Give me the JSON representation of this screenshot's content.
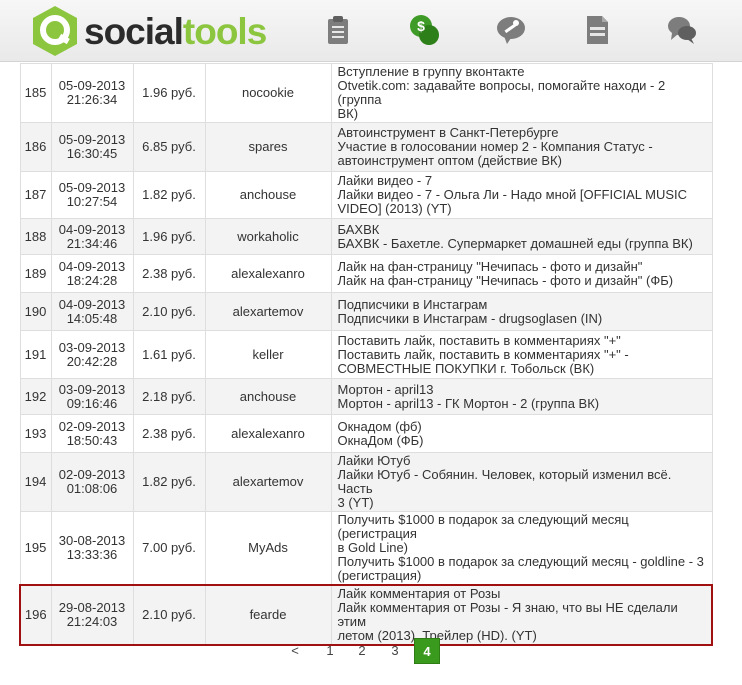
{
  "header": {
    "logo_part1": "social",
    "logo_part2": "tools",
    "nav": [
      {
        "icon": "clipboard-icon"
      },
      {
        "icon": "money-icon"
      },
      {
        "icon": "wrench-icon"
      },
      {
        "icon": "document-icon"
      },
      {
        "icon": "chat-icon"
      }
    ]
  },
  "table": {
    "rows": [
      {
        "id": "185",
        "date": "05-09-2013",
        "time": "21:26:34",
        "price": "1.96 руб.",
        "user": "nocookie",
        "lines": [
          "Вступление в группу вконтакте",
          "Otvetik.com: задавайте вопросы, помогайте находи - 2 (группа",
          "ВК)"
        ]
      },
      {
        "id": "186",
        "date": "05-09-2013",
        "time": "16:30:45",
        "price": "6.85 руб.",
        "user": "spares",
        "lines": [
          "Автоинструмент в Санкт-Петербурге",
          "Участие в голосовании номер 2 - Компания Статус -",
          "автоинструмент оптом (действие ВК)"
        ]
      },
      {
        "id": "187",
        "date": "05-09-2013",
        "time": "10:27:54",
        "price": "1.82 руб.",
        "user": "anchouse",
        "lines": [
          "Лайки видео - 7",
          "Лайки видео - 7 - Ольга Ли - Надо мной [OFFICIAL MUSIC",
          "VIDEO] (2013) (YT)"
        ]
      },
      {
        "id": "188",
        "date": "04-09-2013",
        "time": "21:34:46",
        "price": "1.96 руб.",
        "user": "workaholic",
        "lines": [
          "БАХВК",
          "БАХВК - Бахетле. Супермаркет домашней еды (группа ВК)"
        ]
      },
      {
        "id": "189",
        "date": "04-09-2013",
        "time": "18:24:28",
        "price": "2.38 руб.",
        "user": "alexalexanro",
        "lines": [
          "Лайк на фан-страницу \"Нечипась - фото и дизайн\"",
          "Лайк на фан-страницу \"Нечипась - фото и дизайн\" (ФБ)"
        ]
      },
      {
        "id": "190",
        "date": "04-09-2013",
        "time": "14:05:48",
        "price": "2.10 руб.",
        "user": "alexartemov",
        "lines": [
          "Подписчики в Инстаграм",
          "Подписчики в Инстаграм - drugsoglasen (IN)"
        ]
      },
      {
        "id": "191",
        "date": "03-09-2013",
        "time": "20:42:28",
        "price": "1.61 руб.",
        "user": "keller",
        "lines": [
          "Поставить лайк, поставить в комментариях \"+\"",
          "Поставить лайк, поставить в комментариях \"+\" -",
          "СОВМЕСТНЫЕ ПОКУПКИ г. Тобольск (ВК)"
        ]
      },
      {
        "id": "192",
        "date": "03-09-2013",
        "time": "09:16:46",
        "price": "2.18 руб.",
        "user": "anchouse",
        "lines": [
          "Мортон - april13",
          "Мортон - april13 - ГК Мортон - 2 (группа ВК)"
        ]
      },
      {
        "id": "193",
        "date": "02-09-2013",
        "time": "18:50:43",
        "price": "2.38 руб.",
        "user": "alexalexanro",
        "lines": [
          "Окнадом (фб)",
          "ОкнаДом (ФБ)"
        ]
      },
      {
        "id": "194",
        "date": "02-09-2013",
        "time": "01:08:06",
        "price": "1.82 руб.",
        "user": "alexartemov",
        "lines": [
          "Лайки Ютуб",
          "Лайки Ютуб - Собянин. Человек, который изменил всё. Часть",
          "3 (YT)"
        ]
      },
      {
        "id": "195",
        "date": "30-08-2013",
        "time": "13:33:36",
        "price": "7.00 руб.",
        "user": "MyAds",
        "lines": [
          "Получить $1000 в подарок за следующий месяц (регистрация",
          "в Gold Line)",
          "Получить $1000 в подарок за следующий месяц - goldline - 3",
          "(регистрация)"
        ]
      },
      {
        "id": "196",
        "date": "29-08-2013",
        "time": "21:24:03",
        "price": "2.10 руб.",
        "user": "fearde",
        "lines": [
          "Лайк комментария от Розы",
          "Лайк комментария от Розы - Я знаю, что вы НЕ сделали этим",
          "летом (2013). Трейлер (HD). (YT)"
        ]
      }
    ]
  },
  "pagination": {
    "prev": "<",
    "pages": [
      "1",
      "2",
      "3",
      "4"
    ],
    "active": "4"
  },
  "colors": {
    "brand_green": "#8cc63f",
    "active_page": "#3a9a1d",
    "highlight_border": "#a01010"
  }
}
